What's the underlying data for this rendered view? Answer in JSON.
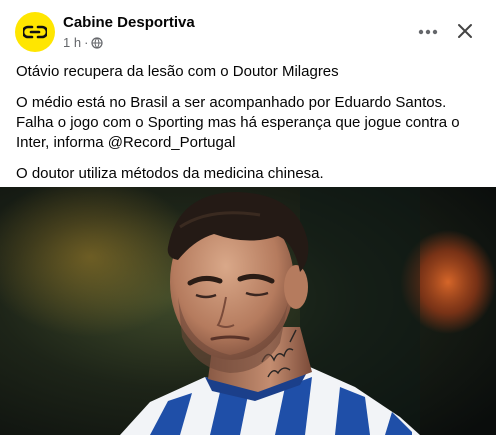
{
  "post": {
    "page_name": "Cabine Desportiva",
    "time": "1 h",
    "separator": "·",
    "paragraphs": [
      "Otávio recupera da lesão com o Doutor Milagres",
      "O médio está no Brasil a ser acompanhado por Eduardo Santos. Falha o jogo com o Sporting mas há esperança que jogue contra o Inter, informa @Record_Portugal",
      "O doutor utiliza métodos da medicina chinesa."
    ],
    "photo": {
      "subject": "football-player-portrait",
      "tattoo_text": "Alive"
    }
  },
  "colors": {
    "avatar_bg": "#ffe600",
    "text": "#050505",
    "meta": "#65676b",
    "jersey_blue": "#1f4fa8"
  },
  "icons": [
    "page-logo-icon",
    "globe-icon",
    "more-options-icon",
    "close-icon"
  ]
}
